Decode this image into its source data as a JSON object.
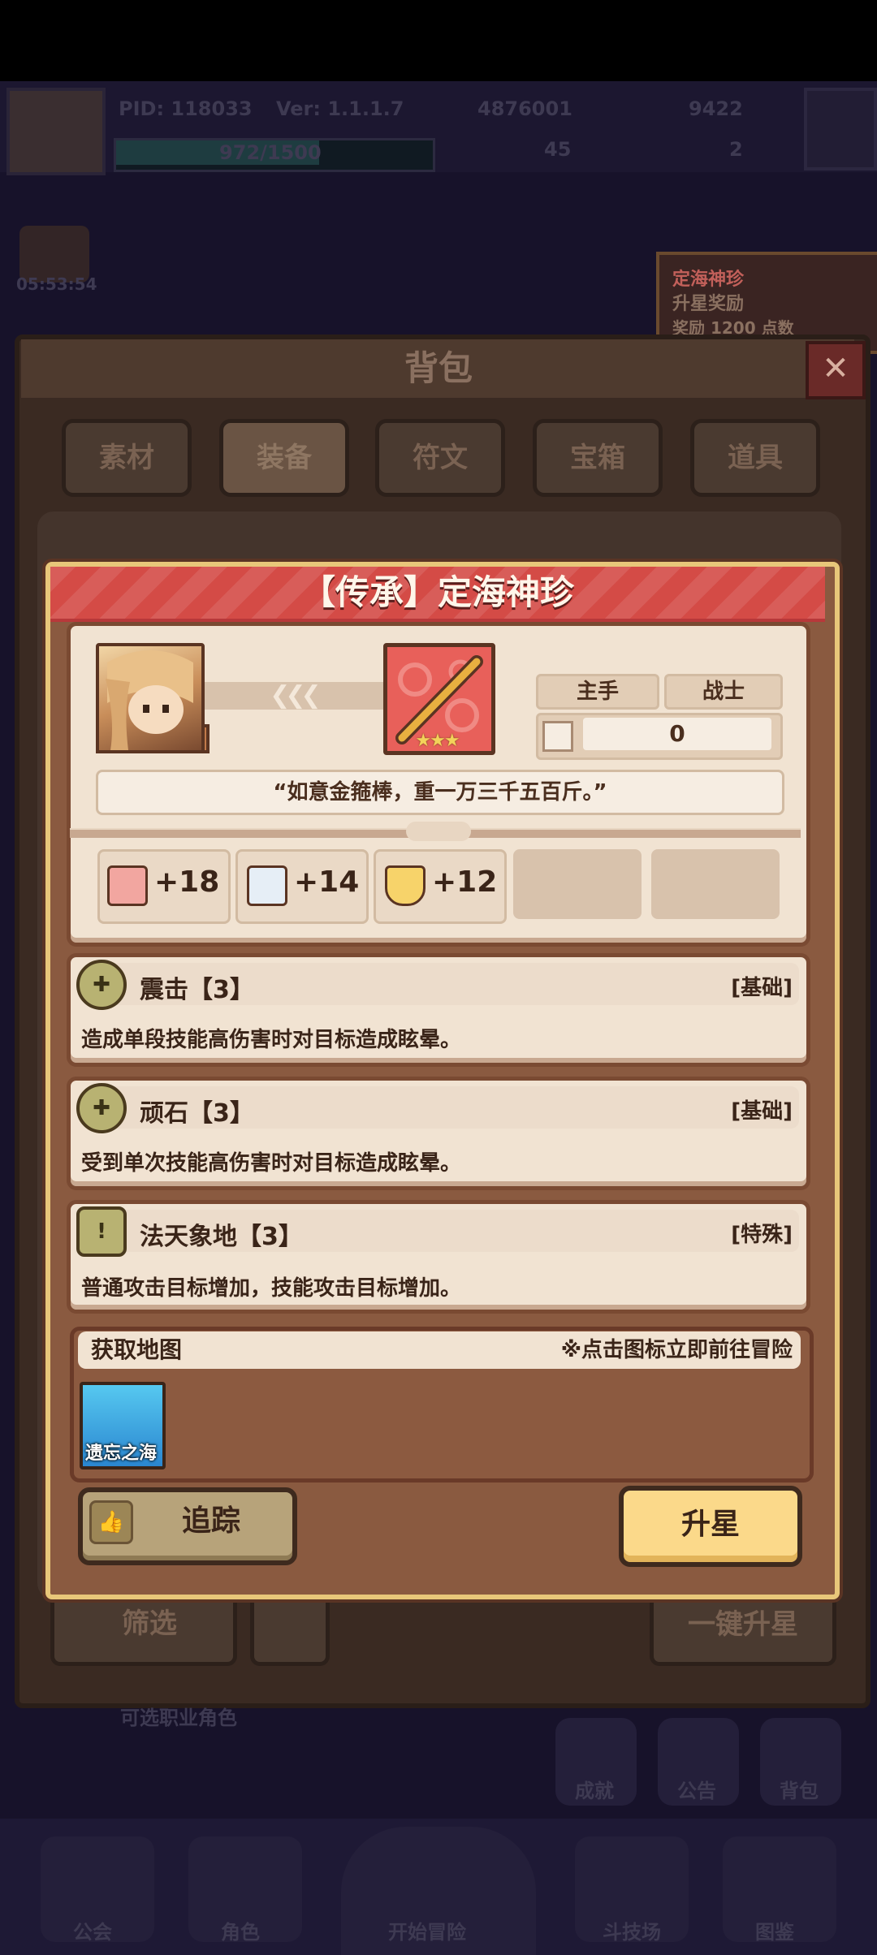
{
  "colors": {
    "modal_header": "#d44b46",
    "modal_border": "#e8c77a",
    "section_bg": "#f1e3d2",
    "upgrade_button": "#fbd98a",
    "track_button": "#b7a37a"
  },
  "background": {
    "player_id": "PID: 118033",
    "version": "Ver: 1.1.1.7",
    "gold": "4876001",
    "gems": "9422",
    "exp": "972/1500",
    "currency_a": "45",
    "currency_b": "2",
    "timer": "05:53:54",
    "event_banner": {
      "title": "定海神珍",
      "subtitle": "升星奖励",
      "reward": "奖励 1200 点数"
    },
    "backpack": {
      "title": "背包",
      "close": "✕",
      "tabs": [
        "素材",
        "装备",
        "符文",
        "宝箱",
        "道具"
      ],
      "filter_label": "筛选",
      "star_all_label": "一键升星"
    },
    "bottom_hint": "可选职业角色",
    "side_buttons": [
      "成就",
      "公告",
      "背包"
    ],
    "nav": [
      "公会",
      "角色",
      "开始冒险",
      "斗技场",
      "图鉴"
    ]
  },
  "item": {
    "title": "【传承】定海神珍",
    "slot": "主手",
    "class": "战士",
    "socket_value": "0",
    "quote": "“如意金箍棒，重一万三千五百斤。”",
    "stars": "★★★",
    "arrows": "❮❮❮",
    "stats": [
      {
        "icon": "fist-icon",
        "value": "+18"
      },
      {
        "icon": "gloves-icon",
        "value": "+14"
      },
      {
        "icon": "shield-icon",
        "value": "+12"
      }
    ],
    "skills": [
      {
        "icon_glyph": "✚",
        "name": "震击【3】",
        "type": "[基础]",
        "desc": "造成单段技能高伤害时对目标造成眩晕。"
      },
      {
        "icon_glyph": "✚",
        "name": "顽石【3】",
        "type": "[基础]",
        "desc": "受到单次技能高伤害时对目标造成眩晕。"
      },
      {
        "icon_glyph": "!",
        "name": "法天象地【3】",
        "type": "[特殊]",
        "desc": "普通攻击目标增加，技能攻击目标增加。"
      }
    ],
    "map_section": {
      "title": "获取地图",
      "hint": "※点击图标立即前往冒险",
      "maps": [
        "遗忘之海"
      ]
    },
    "track_label": "追踪",
    "upgrade_label": "升星"
  }
}
